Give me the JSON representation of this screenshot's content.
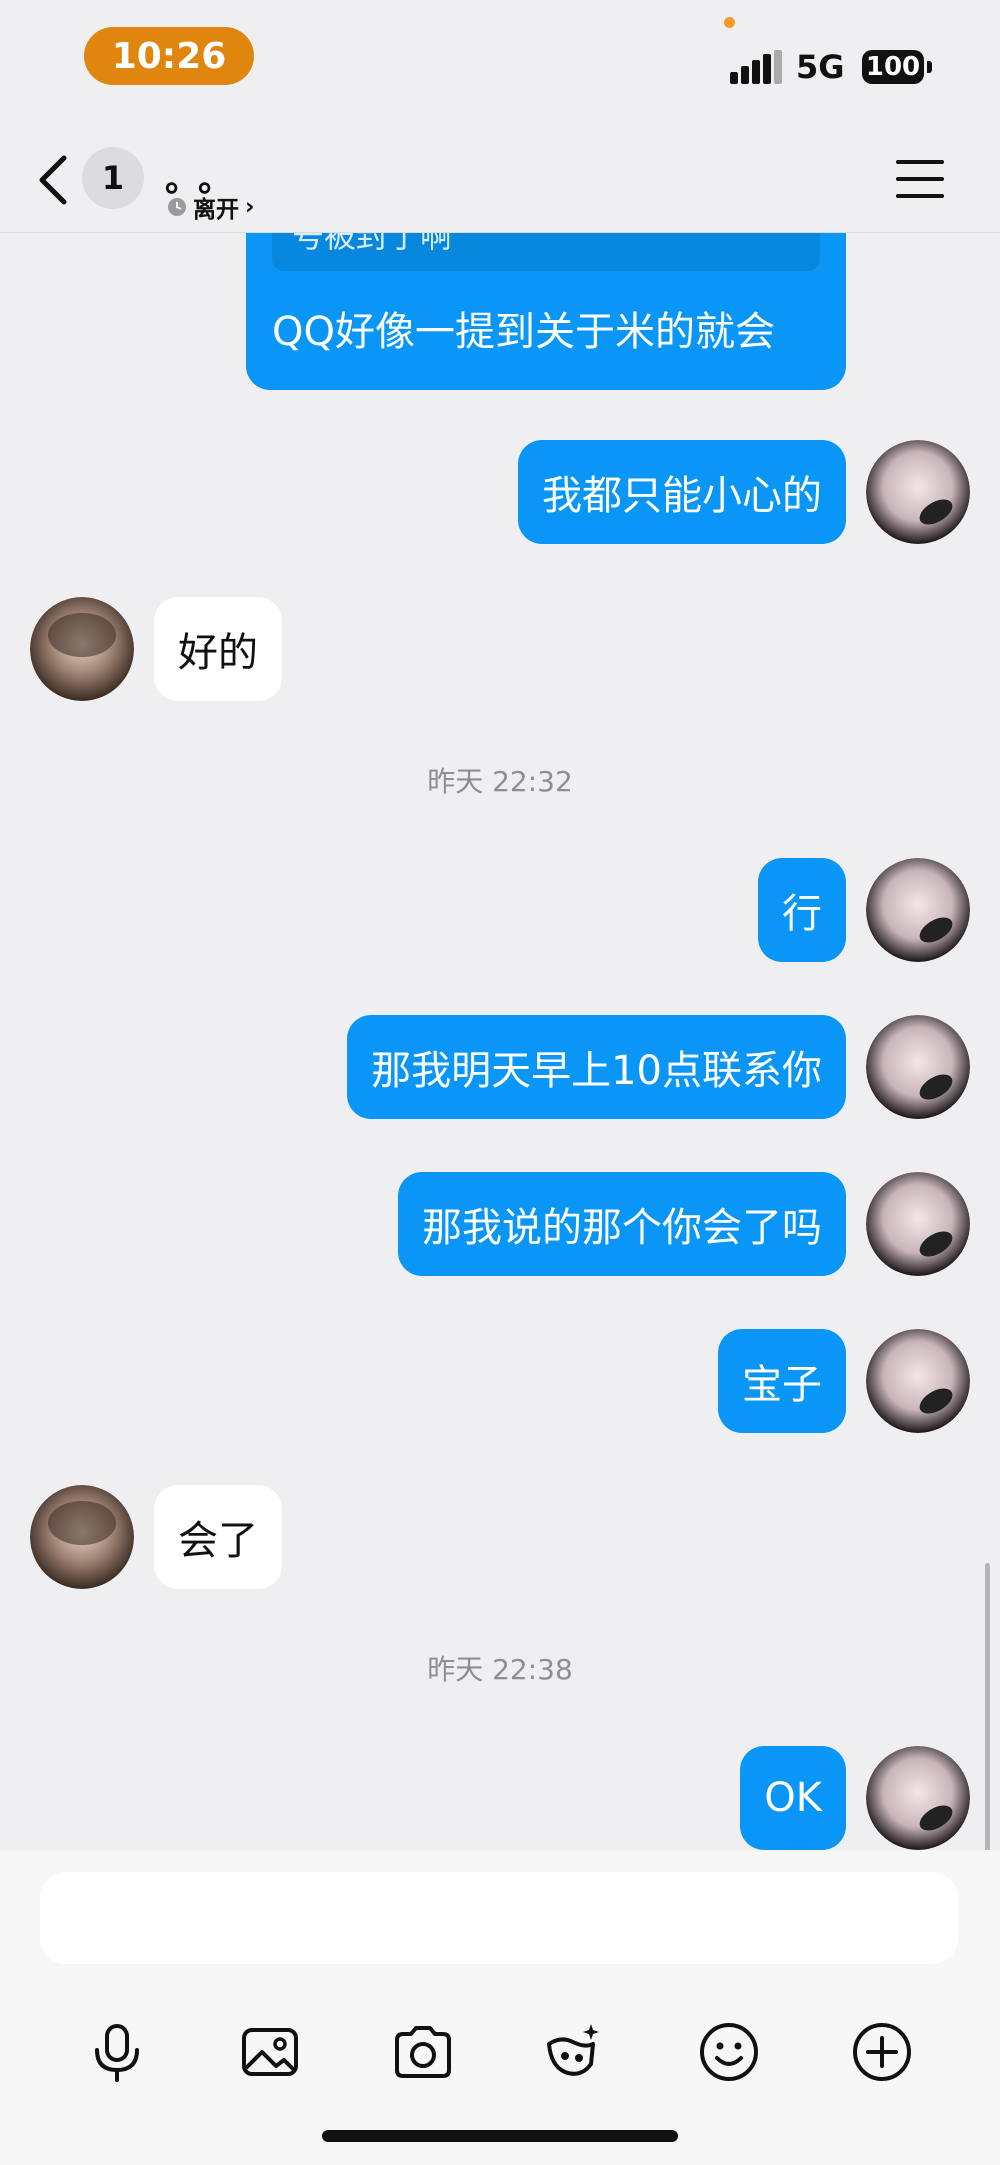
{
  "status_bar": {
    "time": "10:26",
    "network": "5G",
    "battery": "100"
  },
  "header": {
    "unread_count": "1",
    "contact_name": "。。",
    "presence": "离开",
    "presence_chevron": "›"
  },
  "chat": {
    "quoted_message": {
      "quote_text": "号被封了啊",
      "text": "QQ好像一提到关于米的就会"
    },
    "messages": [
      {
        "sender": "me",
        "text": "我都只能小心的"
      },
      {
        "sender": "other",
        "text": "好的"
      },
      {
        "sender": "me",
        "text": "行"
      },
      {
        "sender": "me",
        "text": "那我明天早上10点联系你"
      },
      {
        "sender": "me",
        "text": "那我说的那个你会了吗"
      },
      {
        "sender": "me",
        "text": "宝子"
      },
      {
        "sender": "other",
        "text": "会了"
      },
      {
        "sender": "me",
        "text": "OK"
      }
    ],
    "timestamps": [
      "昨天 22:32",
      "昨天 22:38"
    ]
  },
  "input": {
    "value": "",
    "placeholder": ""
  },
  "toolbar": [
    "microphone-icon",
    "image-icon",
    "camera-icon",
    "magic-pet-icon",
    "emoji-icon",
    "plus-icon"
  ],
  "colors": {
    "my_bubble": "#0a96f7",
    "other_bubble": "#ffffff",
    "time_pill": "#e0860f",
    "background": "#efeff1"
  }
}
